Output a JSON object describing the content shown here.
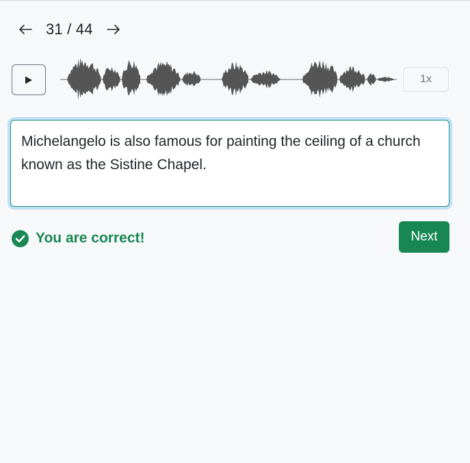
{
  "pager": {
    "current": "31",
    "total": "44",
    "display": "31 / 44",
    "prev_icon": "arrow-left-icon",
    "next_icon": "arrow-right-icon"
  },
  "player": {
    "play_icon": "play-icon",
    "speed_label": "1x"
  },
  "answer": {
    "text": "Michelangelo is also famous for painting the ceiling of a church known as the Sistine Chapel."
  },
  "feedback": {
    "icon": "check-circle-icon",
    "message": "You are correct!"
  },
  "actions": {
    "next_label": "Next"
  },
  "colors": {
    "success": "#198754",
    "focus_ring": "#bfe0f7",
    "waveform": "#555555",
    "background": "#f7f8fa"
  }
}
